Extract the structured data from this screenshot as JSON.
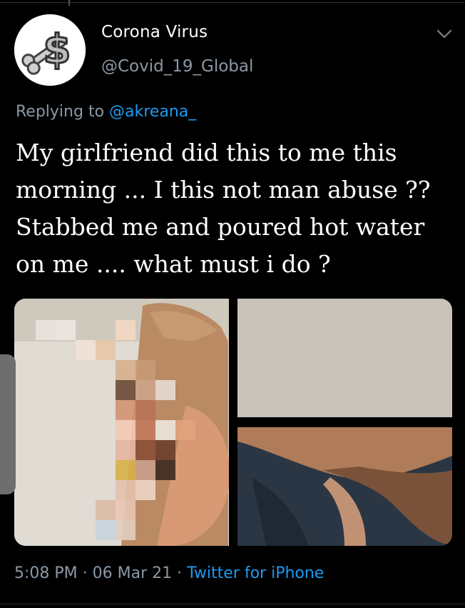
{
  "tweet": {
    "display_name": "Corona Virus",
    "handle": "@Covid_19_Global",
    "reply_prefix": "Replying to",
    "reply_to": "@akreana_",
    "text": "My girlfriend did this to me this morning ... I this not man abuse ?? Stabbed me and poured hot water on me .... what must i do ?",
    "time": "5:08 PM",
    "separator": " · ",
    "date": "06 Mar 21",
    "separator2": " · ",
    "source": "Twitter for iPhone"
  },
  "icons": {
    "avatar": "dollar-sign-bone-icon",
    "menu": "chevron-down-icon"
  },
  "colors": {
    "background": "#000000",
    "text": "#ffffff",
    "secondary_text": "#8b98a5",
    "link": "#1d9bf0"
  }
}
